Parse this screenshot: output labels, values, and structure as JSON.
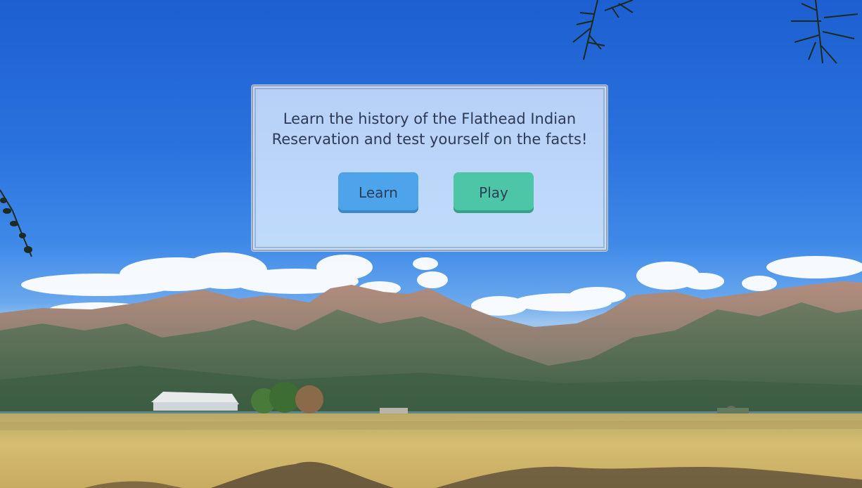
{
  "intro": {
    "tagline": "Learn the history of the Flathead Indian Reservation and test yourself on the facts!"
  },
  "actions": {
    "learn_label": "Learn",
    "play_label": "Play"
  },
  "colors": {
    "sky": "#2a72de",
    "learn_button": "#4ea4ea",
    "play_button": "#4dc6a8",
    "text": "#2e3a55",
    "field": "#c9b36a",
    "mountains": "#4e6a52"
  }
}
